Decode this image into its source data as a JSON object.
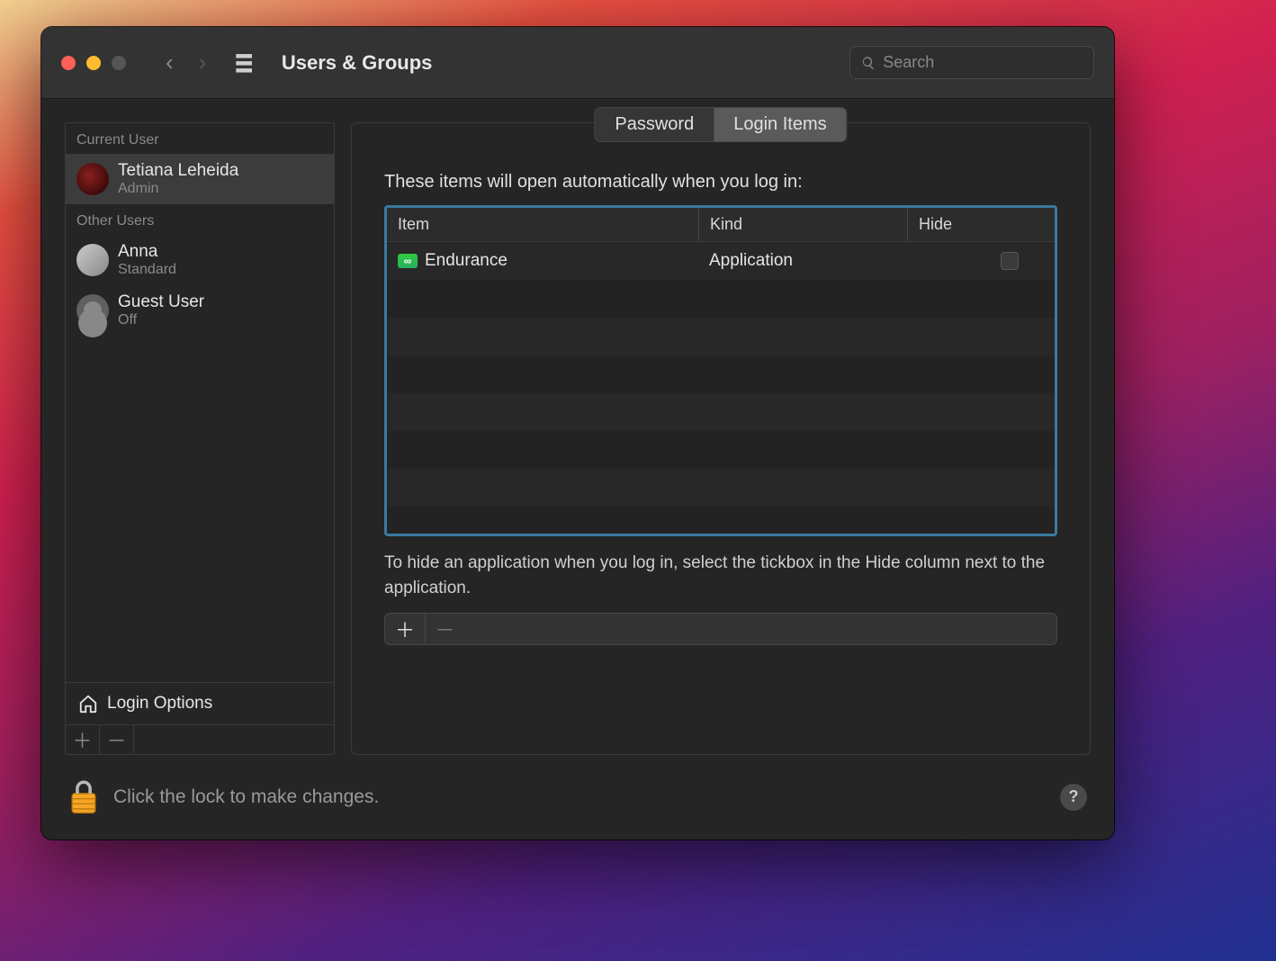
{
  "window": {
    "title": "Users & Groups"
  },
  "search": {
    "placeholder": "Search",
    "value": ""
  },
  "sidebar": {
    "current_label": "Current User",
    "other_label": "Other Users",
    "current_user": {
      "name": "Tetiana Leheida",
      "role": "Admin"
    },
    "other_users": [
      {
        "name": "Anna",
        "role": "Standard"
      },
      {
        "name": "Guest User",
        "role": "Off"
      }
    ],
    "login_options_label": "Login Options"
  },
  "tabs": {
    "password": "Password",
    "login_items": "Login Items",
    "active": "login_items"
  },
  "main": {
    "description": "These items will open automatically when you log in:",
    "columns": {
      "item": "Item",
      "kind": "Kind",
      "hide": "Hide"
    },
    "rows": [
      {
        "icon": "infinity",
        "name": "Endurance",
        "kind": "Application",
        "hide": false
      }
    ],
    "hint": "To hide an application when you log in, select the tickbox in the Hide column next to the application."
  },
  "footer": {
    "text": "Click the lock to make changes."
  }
}
